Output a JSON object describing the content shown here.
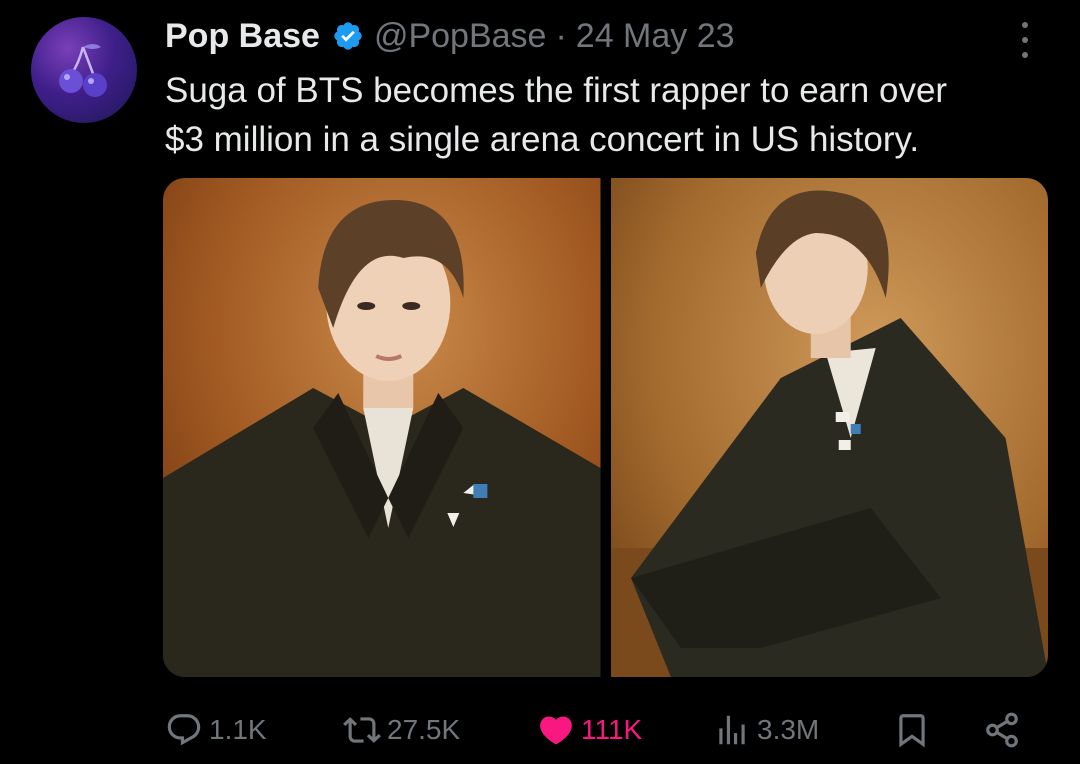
{
  "tweet": {
    "display_name": "Pop Base",
    "handle": "@PopBase",
    "separator": "·",
    "date": "24 May 23",
    "text_line1": "Suga of BTS becomes the first rapper to earn over",
    "text_line2": "$3 million in a single arena concert in US history.",
    "verified": true,
    "avatar_icon": "cherry-icon",
    "media_count": 2
  },
  "actions": {
    "replies": "1.1K",
    "retweets": "27.5K",
    "likes": "111K",
    "views": "3.3M"
  },
  "icons": {
    "reply": "reply-icon",
    "retweet": "retweet-icon",
    "like": "heart-icon",
    "views": "views-icon",
    "bookmark": "bookmark-icon",
    "share": "share-icon",
    "more": "more-options-icon"
  },
  "colors": {
    "background": "#000000",
    "text": "#e7e9ea",
    "secondary": "#71767b",
    "verified": "#1d9bf0",
    "like": "#f91880"
  }
}
